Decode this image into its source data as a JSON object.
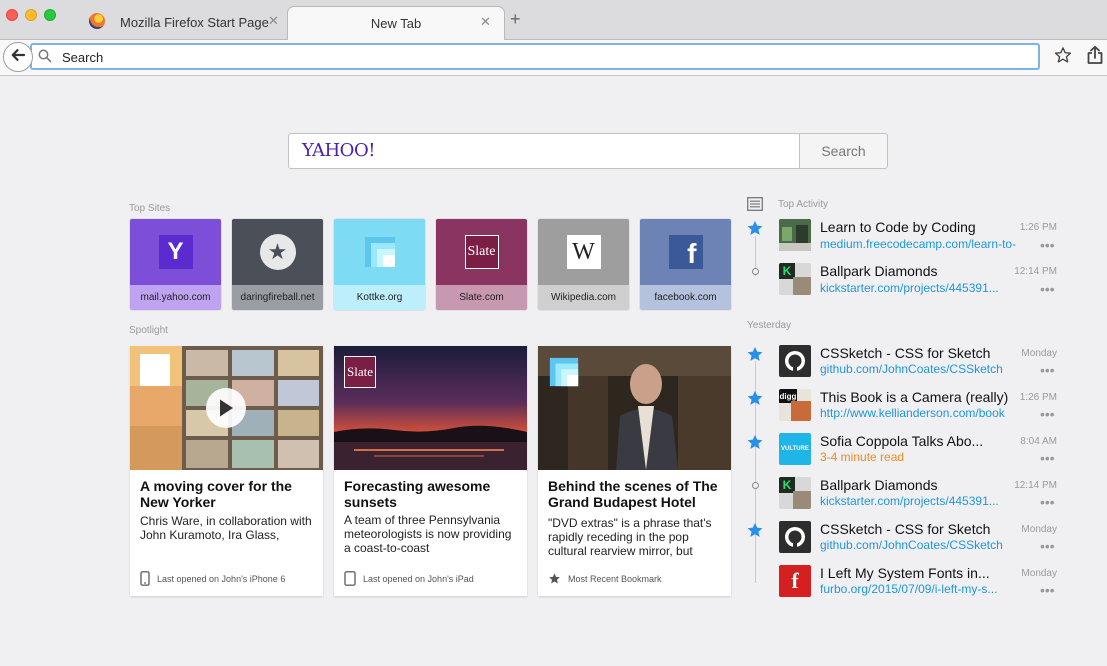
{
  "browser": {
    "tabs": [
      {
        "title": "Mozilla Firefox Start Page",
        "close": "✕"
      },
      {
        "title": "New Tab",
        "close": "✕"
      }
    ],
    "new_tab": "+",
    "url_placeholder": "Search"
  },
  "search": {
    "logo": "YAHOO!",
    "button": "Search"
  },
  "top_sites": {
    "label": "Top Sites",
    "items": [
      {
        "label": "mail.yahoo.com",
        "glyph": "Y",
        "icon": "yahoo-logo-icon",
        "color": "#7d4fd9"
      },
      {
        "label": "daringfireball.net",
        "glyph": "★",
        "icon": "star-circle-icon",
        "color": "#4a4f58"
      },
      {
        "label": "Kottke.org",
        "glyph": "",
        "icon": "kottke-squares-icon",
        "color": "#7ddcf4"
      },
      {
        "label": "Slate.com",
        "glyph": "Slate",
        "icon": "slate-logo-icon",
        "color": "#8a3561"
      },
      {
        "label": "Wikipedia.com",
        "glyph": "W",
        "icon": "wikipedia-logo-icon",
        "color": "#9e9e9e"
      },
      {
        "label": "facebook.com",
        "glyph": "f",
        "icon": "facebook-logo-icon",
        "color": "#6d83b5"
      }
    ]
  },
  "spotlight": {
    "label": "Spotlight",
    "cards": [
      {
        "title": "A moving cover for the New Yorker",
        "desc": "Chris Ware, in collaboration with John Kuramoto, Ira Glass,",
        "footer": "Last opened on John's iPhone 6",
        "footer_icon": "phone-icon"
      },
      {
        "title": "Forecasting awesome sunsets",
        "desc": "A team of three Pennsylvania meteorologists is now providing a coast-to-coast",
        "footer": "Last opened on John's iPad",
        "footer_icon": "tablet-icon",
        "badge": "Slate"
      },
      {
        "title": "Behind the scenes of The Grand Budapest Hotel",
        "desc": "\"DVD extras\" is a phrase that's rapidly receding in the pop cultural rearview mirror, but",
        "footer": "Most Recent Bookmark",
        "footer_icon": "star-icon"
      }
    ]
  },
  "activity": {
    "label": "Top Activity",
    "yesterday_label": "Yesterday",
    "items": [
      {
        "title": "Learn to Code by Coding",
        "sub": "medium.freecodecamp.com/learn-to-...",
        "time": "1:26 PM",
        "marker": "star",
        "thumb": "freecodecamp-icon"
      },
      {
        "title": "Ballpark Diamonds",
        "sub": "kickstarter.com/projects/445391...",
        "time": "12:14 PM",
        "marker": "dot",
        "thumb": "kickstarter-icon"
      },
      {
        "title": "CSSketch - CSS for Sketch",
        "sub": "github.com/JohnCoates/CSSketch",
        "time": "Monday",
        "marker": "star",
        "thumb": "github-icon"
      },
      {
        "title": "This Book is a Camera (really)",
        "sub": "http://www.kellianderson.com/book",
        "time": "1:26 PM",
        "marker": "star",
        "thumb": "digg-icon"
      },
      {
        "title": "Sofia Coppola Talks Abo...",
        "sub": "3-4 minute read",
        "time": "8:04 AM",
        "marker": "star",
        "thumb": "vulture-icon",
        "sub_color": "#e88c20"
      },
      {
        "title": "Ballpark Diamonds",
        "sub": "kickstarter.com/projects/445391...",
        "time": "12:14 PM",
        "marker": "dot",
        "thumb": "kickstarter-icon"
      },
      {
        "title": "CSSketch - CSS for Sketch",
        "sub": "github.com/JohnCoates/CSSketch",
        "time": "Monday",
        "marker": "star",
        "thumb": "github-icon"
      },
      {
        "title": "I Left My System Fonts in...",
        "sub": "furbo.org/2015/07/09/i-left-my-s...",
        "time": "Monday",
        "marker": "dot",
        "thumb": "furbo-icon"
      }
    ],
    "thumb_texts": {
      "kickstarter": "K",
      "digg": "digg",
      "vulture": "VULTURE",
      "furbo": "f"
    },
    "more": "•••"
  }
}
